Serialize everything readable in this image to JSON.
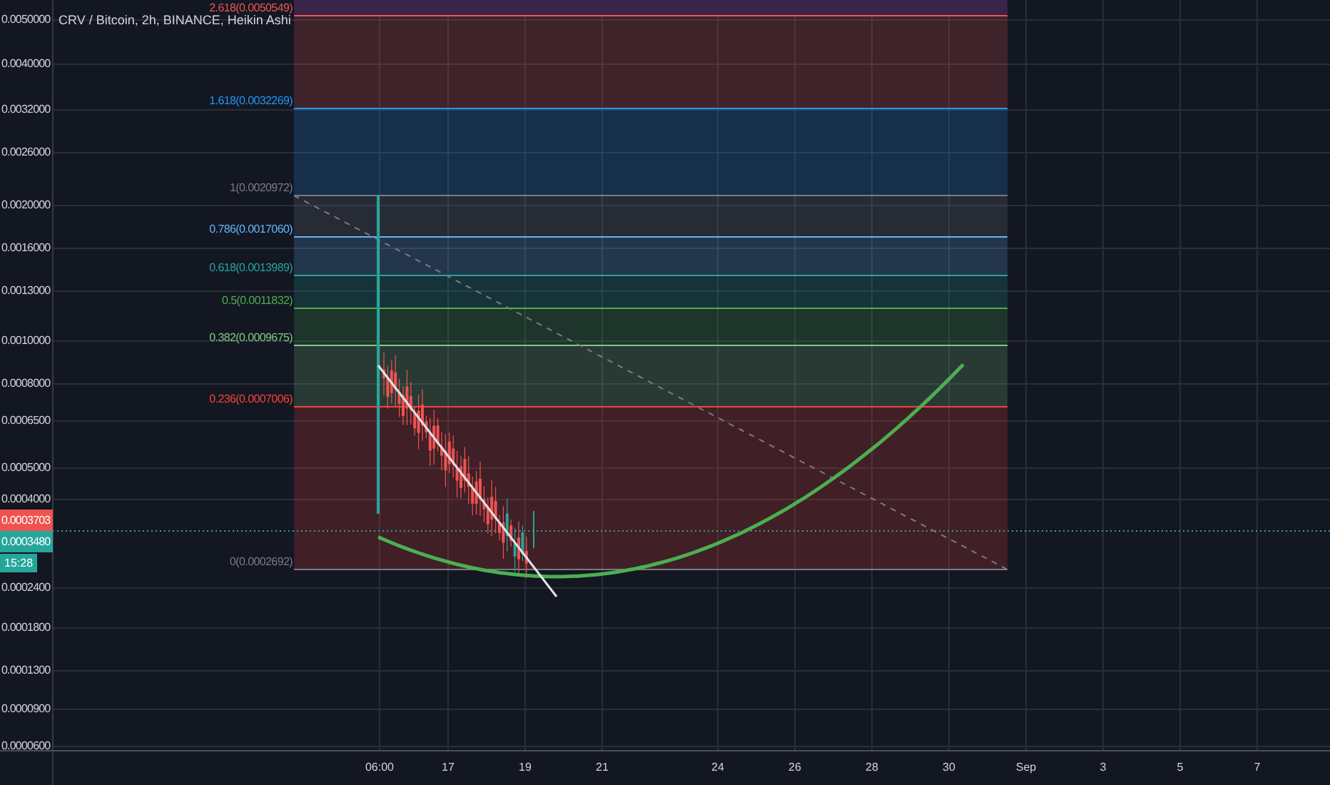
{
  "chart": {
    "title": "CRV / Bitcoin, 2h, BINANCE, Heikin Ashi"
  },
  "price_axis": {
    "labels": [
      "0.0050000",
      "0.0040000",
      "0.0032000",
      "0.0026000",
      "0.0020000",
      "0.0016000",
      "0.0013000",
      "0.0010000",
      "0.0008000",
      "0.0006500",
      "0.0005000",
      "0.0004000",
      "0.0002400",
      "0.0001800",
      "0.0001300",
      "0.0000900",
      "0.0000600"
    ]
  },
  "price_badges": [
    {
      "text": "0.0003703",
      "color": "#ef5350"
    },
    {
      "text": "0.0003480",
      "color": "#26a69a"
    }
  ],
  "countdown": "15:28",
  "time_axis": {
    "labels": [
      "06:00",
      "17",
      "19",
      "21",
      "24",
      "26",
      "28",
      "30",
      "Sep",
      "3",
      "5",
      "7"
    ]
  },
  "fib_levels": [
    {
      "label": "2.618(0.0050549)",
      "color": "#ef5350"
    },
    {
      "label": "1.618(0.0032269)",
      "color": "#2196f3"
    },
    {
      "label": "1(0.0020972)",
      "color": "#787b86"
    },
    {
      "label": "0.786(0.0017060)",
      "color": "#64b5f6"
    },
    {
      "label": "0.618(0.0013989)",
      "color": "#26a69a"
    },
    {
      "label": "0.5(0.0011832)",
      "color": "#4caf50"
    },
    {
      "label": "0.382(0.0009675)",
      "color": "#81c784"
    },
    {
      "label": "0.236(0.0007006)",
      "color": "#f44336"
    },
    {
      "label": "0(0.0002692)",
      "color": "#787b86"
    }
  ]
}
